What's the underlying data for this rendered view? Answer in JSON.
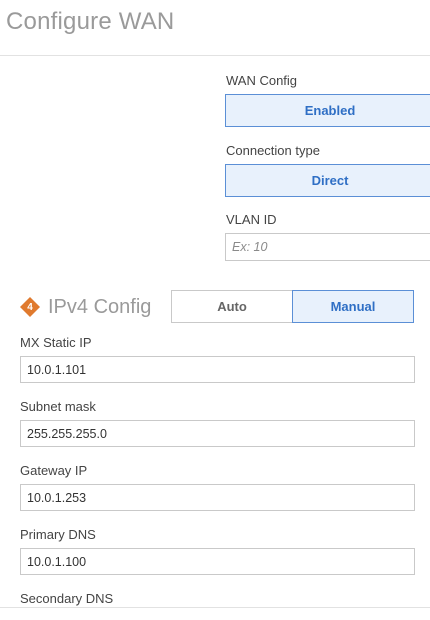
{
  "page": {
    "title": "Configure WAN"
  },
  "wan_config": {
    "label": "WAN Config",
    "value": "Enabled"
  },
  "connection_type": {
    "label": "Connection type",
    "value": "Direct"
  },
  "vlan": {
    "label": "VLAN ID",
    "placeholder": "Ex: 10"
  },
  "ipv4": {
    "step": "4",
    "title": "IPv4 Config",
    "modes": [
      "Auto",
      "Manual"
    ],
    "selected_mode": "Manual"
  },
  "fields": [
    {
      "label": "MX Static IP",
      "value": "10.0.1.101"
    },
    {
      "label": "Subnet mask",
      "value": "255.255.255.0"
    },
    {
      "label": "Gateway IP",
      "value": "10.0.1.253"
    },
    {
      "label": "Primary DNS",
      "value": "10.0.1.100"
    },
    {
      "label": "Secondary DNS"
    }
  ],
  "colors": {
    "accent": "#2f6fc5",
    "step_icon": "#e07a2e"
  }
}
